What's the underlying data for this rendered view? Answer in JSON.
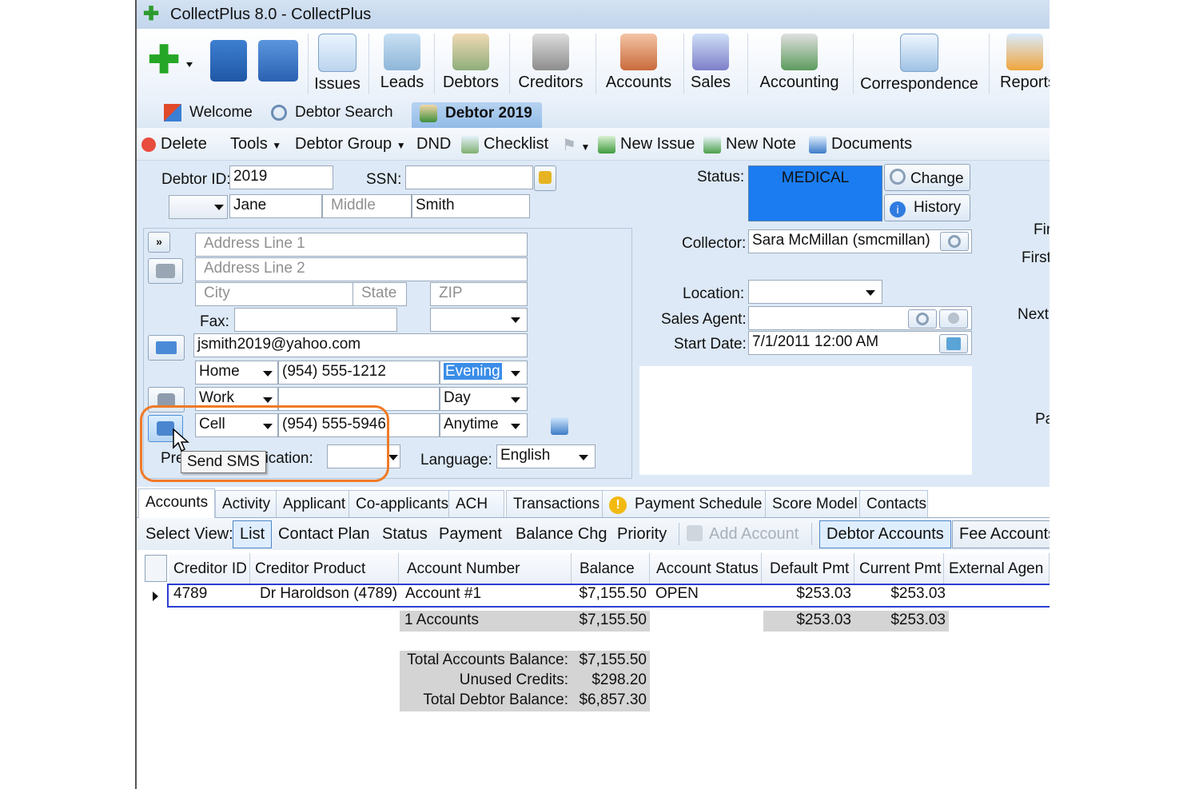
{
  "window": {
    "title": "CollectPlus 8.0 - CollectPlus"
  },
  "ribbon": {
    "buttons": [
      "Issues",
      "Leads",
      "Debtors",
      "Creditors",
      "Accounts",
      "Sales",
      "Accounting",
      "Correspondence",
      "Reports"
    ]
  },
  "tabs": [
    "Welcome",
    "Debtor Search",
    "Debtor 2019"
  ],
  "toolbar": {
    "delete": "Delete",
    "tools": "Tools",
    "debtor_group": "Debtor Group",
    "dnd": "DND",
    "checklist": "Checklist",
    "new_issue": "New Issue",
    "new_note": "New Note",
    "documents": "Documents"
  },
  "form": {
    "debtor_id_label": "Debtor ID:",
    "debtor_id": "2019",
    "ssn_label": "SSN:",
    "first_name": "Jane",
    "middle_placeholder": "Middle",
    "last_name": "Smith",
    "address1_placeholder": "Address Line 1",
    "address2_placeholder": "Address Line 2",
    "city_placeholder": "City",
    "state_placeholder": "State",
    "zip_placeholder": "ZIP",
    "fax_label": "Fax:",
    "email": "jsmith2019@yahoo.com",
    "phones": [
      {
        "type": "Home",
        "number": "(954) 555-1212",
        "time": "Evening"
      },
      {
        "type": "Work",
        "number": "",
        "time": "Day"
      },
      {
        "type": "Cell",
        "number": "(954) 555-5946",
        "time": "Anytime"
      }
    ],
    "pref_label_left": "Pre",
    "pref_label_right": "nication:",
    "tooltip": "Send SMS",
    "language_label": "Language:",
    "language": "English",
    "status_label": "Status:",
    "status_value": "MEDICAL",
    "status_color": "#1a7cf0",
    "change_button": "Change",
    "history_button": "History",
    "collector_label": "Collector:",
    "collector": "Sara McMillan (smcmillan)",
    "location_label": "Location:",
    "sales_agent_label": "Sales Agent:",
    "start_date_label": "Start Date:",
    "start_date": "7/1/2011 12:00 AM",
    "right_labels": [
      "Fir",
      "First",
      "Next",
      "Pa"
    ]
  },
  "bottom_tabs": [
    "Accounts",
    "Activity",
    "Applicant",
    "Co-applicants",
    "ACH",
    "Transactions",
    "Payment Schedule",
    "Score Model",
    "Contacts"
  ],
  "view_bar": {
    "label": "Select View:",
    "views": [
      "List",
      "Contact Plan",
      "Status",
      "Payment",
      "Balance Chg",
      "Priority"
    ],
    "add_account": "Add Account",
    "debtor_accounts": "Debtor Accounts",
    "fee_accounts": "Fee Accounts"
  },
  "grid": {
    "columns": [
      "Creditor ID",
      "Creditor Product",
      "Account Number",
      "Balance",
      "Account Status",
      "Default Pmt",
      "Current Pmt",
      "External Agen"
    ],
    "rows": [
      {
        "creditor_id": "4789",
        "creditor_product": "Dr Haroldson (4789)",
        "account_number": "Account #1",
        "balance": "$7,155.50",
        "status": "OPEN",
        "default_pmt": "$253.03",
        "current_pmt": "$253.03"
      }
    ],
    "summary": {
      "count": "1 Accounts",
      "balance": "$7,155.50",
      "default_pmt": "$253.03",
      "current_pmt": "$253.03"
    },
    "totals": [
      {
        "label": "Total Accounts Balance:",
        "value": "$7,155.50"
      },
      {
        "label": "Unused Credits:",
        "value": "$298.20"
      },
      {
        "label": "Total Debtor Balance:",
        "value": "$6,857.30"
      }
    ]
  }
}
